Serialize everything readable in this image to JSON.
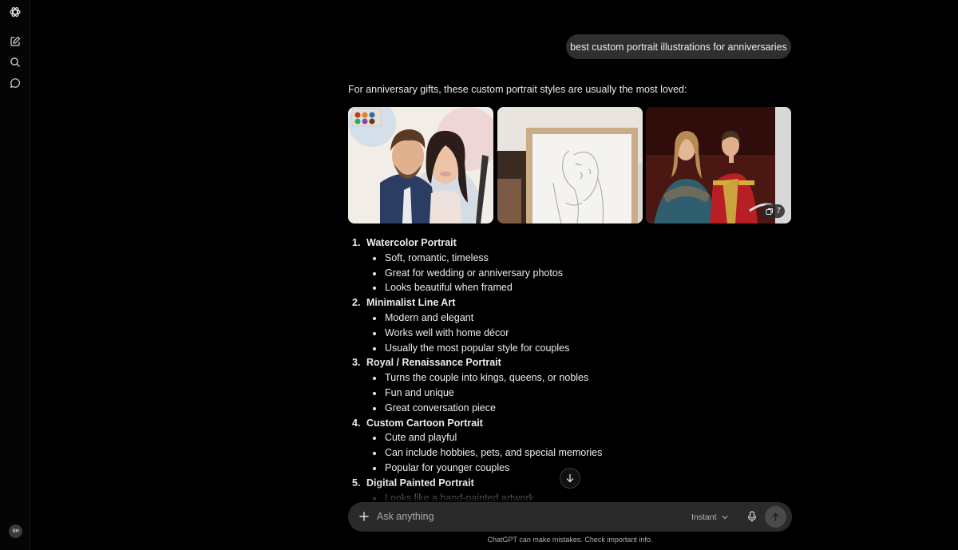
{
  "sidebar": {
    "logo_icon": "openai-logo-icon",
    "new_chat_icon": "new-chat-icon",
    "search_icon": "search-icon",
    "chats_icon": "chat-bubble-icon",
    "avatar_initials": "SH"
  },
  "conversation": {
    "user_message": "best custom portrait illustrations for anniversaries",
    "intro": "For anniversary gifts, these custom portrait styles are usually the most loved:",
    "images": {
      "tiles": [
        {
          "name": "watercolor-couple-portrait"
        },
        {
          "name": "line-art-framed-portrait"
        },
        {
          "name": "royal-couple-portrait"
        }
      ],
      "more_count": "7"
    },
    "styles": [
      {
        "num": "1.",
        "title": "Watercolor Portrait",
        "bullets": [
          "Soft, romantic, timeless",
          "Great for wedding or anniversary photos",
          "Looks beautiful when framed"
        ]
      },
      {
        "num": "2.",
        "title": "Minimalist Line Art",
        "bullets": [
          "Modern and elegant",
          "Works well with home décor",
          "Usually the most popular style for couples"
        ]
      },
      {
        "num": "3.",
        "title": "Royal / Renaissance Portrait",
        "bullets": [
          "Turns the couple into kings, queens, or nobles",
          "Fun and unique",
          "Great conversation piece"
        ]
      },
      {
        "num": "4.",
        "title": "Custom Cartoon Portrait",
        "bullets": [
          "Cute and playful",
          "Can include hobbies, pets, and special memories",
          "Popular for younger couples"
        ]
      },
      {
        "num": "5.",
        "title": "Digital Painted Portrait",
        "bullets": [
          "Looks like a hand-painted artwork"
        ]
      }
    ]
  },
  "composer": {
    "placeholder": "Ask anything",
    "model": "Instant",
    "plus_icon": "plus-icon",
    "mic_icon": "microphone-icon",
    "send_icon": "arrow-up-icon"
  },
  "disclaimer": "ChatGPT can make mistakes. Check important info."
}
